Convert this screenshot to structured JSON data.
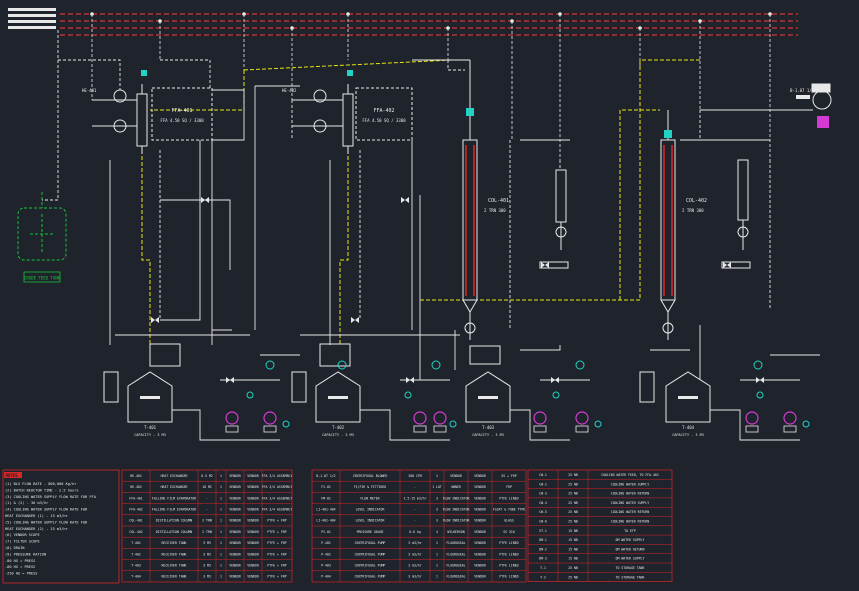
{
  "colors": {
    "background": "#1f232b",
    "line": "#e8e8e8",
    "utility": "#ff3b3b",
    "steam": "#e8e41a",
    "tag": "#22d3c5",
    "pump": "#d63ad6",
    "legend_grid": "#d62828",
    "feed_vessel": "#19c23a"
  },
  "icons": {
    "blower": "centrifugal-blower-icon",
    "motor": "blower-motor-icon",
    "pump": "centrifugal-pump-icon",
    "tank": "storage-tank-icon",
    "evaporator": "falling-film-evaporator-icon",
    "column": "distillation-column-icon",
    "reactor": "jacketed-reactor-icon"
  },
  "notes": {
    "heading": "NOTES",
    "lines": [
      "(1) BLS FLOW RATE - 800,000 Kg/hr",
      "(2) BATCH REACTOR TIME - 2.5 hours",
      "(3) COOLING WATER SUPPLY FLOW RATE FOR FFA",
      "    (1) & (2) - 30 m3/hr",
      "(4) COOLING WATER SUPPLY FLOW RATE FOR",
      "    HEAT EXCHANGER (1) - 15 m3/hr",
      "(5) COOLING WATER SUPPLY FLOW RATE FOR",
      "    HEAT EXCHANGER (2) - 15 m3/hr",
      "(6) VENDOR SCOPE",
      "(7) FILTER SCOPE",
      "(8) DRAIN",
      "(9) PRESSURE RATION",
      "    -80 HG = PRESS",
      "    -80 HG = PRESS",
      "    -250 HG = PRESS"
    ]
  },
  "equipment_list": [
    [
      "HE-401",
      "HEAT EXCHANGER",
      "6.5 M2",
      "1",
      "VENDOR",
      "VENDOR",
      "FFA 3/4 ASSEMBLY"
    ],
    [
      "HE-402",
      "HEAT EXCHANGER",
      "10 M2",
      "1",
      "VENDOR",
      "VENDOR",
      "FFA 3/4 ASSEMBLY"
    ],
    [
      "FFA-401",
      "FALLING FILM EVAPORATOR",
      "-",
      "1",
      "VENDOR",
      "VENDOR",
      "FFA 3/4 ASSEMBLY"
    ],
    [
      "FFA-402",
      "FALLING FILM EVAPORATOR",
      "-",
      "1",
      "VENDOR",
      "VENDOR",
      "FFA 3/4 ASSEMBLY"
    ],
    [
      "COL-401",
      "DISTILLATION COLUMN",
      "2 TRN",
      "1",
      "VENDOR",
      "VENDOR",
      "PTFE + FRP"
    ],
    [
      "COL-402",
      "DISTILLATION COLUMN",
      "2 TRN",
      "1",
      "VENDOR",
      "VENDOR",
      "PTFE + FRP"
    ],
    [
      "T-401",
      "RECEIVER TANK",
      "3 M3",
      "1",
      "VENDOR",
      "VENDOR",
      "PTFE + FRP"
    ],
    [
      "T-402",
      "RECEIVER TANK",
      "3 M3",
      "1",
      "VENDOR",
      "VENDOR",
      "PTFE + FRP"
    ],
    [
      "T-403",
      "RECEIVER TANK",
      "3 M3",
      "1",
      "VENDOR",
      "VENDOR",
      "PTFE + FRP"
    ],
    [
      "T-404",
      "RECEIVER TANK",
      "3 M3",
      "1",
      "VENDOR",
      "VENDOR",
      "PTFE + FRP"
    ]
  ],
  "instrument_list": [
    [
      "B-1.87 1/2",
      "CENTRIFUGAL BLOWER",
      "300 CFM",
      "1",
      "VENDOR",
      "VENDOR",
      "SS + FRP"
    ],
    [
      "FI-01",
      "FI/FIR & FITTINGS",
      "-",
      "1 LOT",
      "OWNER",
      "VENDOR",
      "FRP"
    ],
    [
      "FM-01",
      "FLOW METER",
      "1.5-15 m3/hr",
      "3",
      "FLOW INDICATOR",
      "VENDOR",
      "PTFE LINED"
    ],
    [
      "LI-401-404",
      "LEVEL INDICATOR",
      "-",
      "3",
      "FLOW INDICATOR",
      "VENDOR",
      "FLOAT & TUBE TYPE"
    ],
    [
      "LI-401-404",
      "LEVEL INDICATOR",
      "-",
      "3",
      "FLOW INDICATOR",
      "VENDOR",
      "GLASS"
    ],
    [
      "PI-01",
      "PRESSURE GAUGE",
      "0-6 kg",
      "4",
      "WILKERSON",
      "VENDOR",
      "SS 316"
    ],
    [
      "P-401",
      "CENTRIFUGAL PUMP",
      "3 m3/hr",
      "1",
      "FLUOROSEAL",
      "VENDOR",
      "PTFE LINED"
    ],
    [
      "P-402",
      "CENTRIFUGAL PUMP",
      "3 m3/hr",
      "1",
      "FLUOROSEAL",
      "VENDOR",
      "PTFE LINED"
    ],
    [
      "P-403",
      "CENTRIFUGAL PUMP",
      "3 m3/hr",
      "1",
      "FLUOROSEAL",
      "VENDOR",
      "PTFE LINED"
    ],
    [
      "P-404",
      "CENTRIFUGAL PUMP",
      "3 m3/hr",
      "1",
      "FLUOROSEAL",
      "VENDOR",
      "PTFE LINED"
    ]
  ],
  "line_list": [
    [
      "CW-1",
      "25 NB",
      "COOLING WATER FEED, TO FFA-401"
    ],
    [
      "CW-2",
      "25 NB",
      "COOLING WATER SUPPLY"
    ],
    [
      "CW-3",
      "25 NB",
      "COOLING WATER RETURN"
    ],
    [
      "CW-4",
      "25 NB",
      "COOLING WATER SUPPLY"
    ],
    [
      "CW-5",
      "25 NB",
      "COOLING WATER RETURN"
    ],
    [
      "CW-6",
      "25 NB",
      "COOLING WATER RETURN"
    ],
    [
      "ST-1",
      "15 NB",
      "TO ETP"
    ],
    [
      "DM-1",
      "15 NB",
      "DM WATER SUPPLY"
    ],
    [
      "DM-2",
      "15 NB",
      "DM WATER RETURN"
    ],
    [
      "DM-3",
      "15 NB",
      "DM WATER SUPPLY"
    ],
    [
      "T-1",
      "25 NB",
      "TO STORAGE TANK"
    ],
    [
      "T-2",
      "25 NB",
      "TO STORAGE TANK"
    ]
  ],
  "labels": {
    "ffa1": "FFA-401",
    "ffa1_sub": "FFA 4.50 SQ / 3300",
    "ffa2": "FFA-402",
    "ffa2_sub": "FFA 4.50 SQ / 3300",
    "col1": "COL-401",
    "col1_sub": "2 TRN  300",
    "col2": "COL-402",
    "col2_sub": "2 TRN  300",
    "he1": "HE-401",
    "he2": "HE-402",
    "reactor": "CRUDE FEED TANK",
    "blower_tag": "B-1.87 1/2",
    "tank1": "T-401",
    "tank1_sub": "CAPACITY - 3 M3",
    "tank2": "T-402",
    "tank2_sub": "CAPACITY - 3 M3",
    "tank3": "T-403",
    "tank3_sub": "CAPACITY - 3 M3",
    "tank4": "T-404",
    "tank4_sub": "CAPACITY - 3 M3"
  }
}
